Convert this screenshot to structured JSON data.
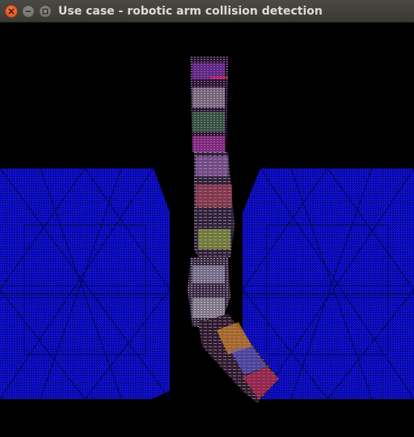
{
  "window": {
    "title": "Use case - robotic arm collision detection",
    "buttons": {
      "close": "close-icon",
      "minimize": "minimize-icon",
      "maximize": "maximize-icon"
    }
  },
  "scene": {
    "description_of_objects": [
      "obstacle-block-left",
      "obstacle-block-right",
      "robotic-arm"
    ],
    "colors": {
      "background": "#000000",
      "obstacle": "#1010e8",
      "obstacle_grid": "#0a0a60",
      "titlebar": "#3f3e3a",
      "close_button": "#e9541f"
    }
  }
}
